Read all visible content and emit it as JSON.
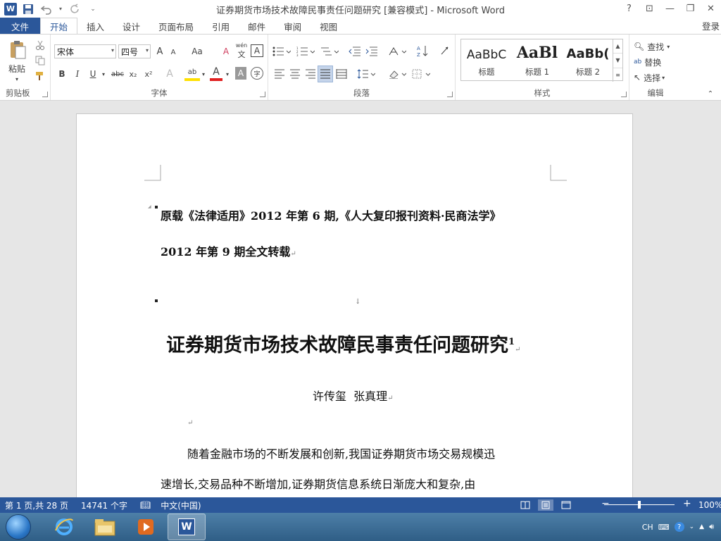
{
  "window": {
    "title": "证券期货市场技术故障民事责任问题研究 [兼容模式] - Microsoft Word",
    "app_icon": "W"
  },
  "quick_access": [
    {
      "icon": "save-icon",
      "glyph": "💾"
    },
    {
      "icon": "undo-icon",
      "glyph": "↶"
    },
    {
      "icon": "redo-icon",
      "glyph": "↻"
    },
    {
      "icon": "customize-icon",
      "glyph": "⌄"
    }
  ],
  "window_buttons": {
    "help": "?",
    "ribbon_options": "⊡",
    "minimize": "—",
    "restore": "❐",
    "close": "✕"
  },
  "tabs": [
    {
      "label": "文件"
    },
    {
      "label": "开始"
    },
    {
      "label": "插入"
    },
    {
      "label": "设计"
    },
    {
      "label": "页面布局"
    },
    {
      "label": "引用"
    },
    {
      "label": "邮件"
    },
    {
      "label": "审阅"
    },
    {
      "label": "视图"
    }
  ],
  "login_label": "登录",
  "ribbon": {
    "clipboard": {
      "label": "剪贴板",
      "paste": "粘贴"
    },
    "font": {
      "label": "字体",
      "font_name": "宋体",
      "font_size": "四号",
      "bold": "B",
      "italic": "I",
      "underline": "U",
      "strike": "abc",
      "subscript": "x₂",
      "superscript": "x²",
      "grow": "A",
      "shrink": "A",
      "case": "Aa",
      "clear": "A",
      "phonetic": "wén",
      "border_char": "A",
      "effects": "A",
      "highlight": "ab",
      "font_color": "A",
      "shading": "A",
      "enclose": "字"
    },
    "paragraph": {
      "label": "段落"
    },
    "styles": {
      "label": "样式",
      "items": [
        {
          "sample": "AaBbC",
          "name": "标题"
        },
        {
          "sample": "AaBl",
          "name": "标题 1"
        },
        {
          "sample": "AaBb(",
          "name": "标题 2"
        }
      ]
    },
    "editing": {
      "label": "编辑",
      "find": "查找",
      "replace": "替换",
      "select": "选择"
    }
  },
  "document": {
    "source_line1": "原载《法律适用》2012 年第 6 期,《人大复印报刊资料·民商法学》",
    "source_line2": "2012 年第 9 期全文转载",
    "title": "证券期货市场技术故障民事责任问题研究",
    "title_footnote": "1",
    "authors": "许传玺  张真理",
    "body_line1": "随着金融市场的不断发展和创新,我国证券期货市场交易规模迅",
    "body_line2": "速增长,交易品种不断增加,证券期货信息系统日渐庞大和复杂,由",
    "para_mark": "↵",
    "line_break_mark": "↓"
  },
  "status": {
    "page": "第 1 页,共 28 页",
    "words": "14741 个字",
    "language": "中文(中国)",
    "zoom": "100%",
    "zoom_level": 0.5
  },
  "taskbar": {
    "apps": [
      {
        "icon": "ie-icon"
      },
      {
        "icon": "explorer-icon"
      },
      {
        "icon": "media-player-icon"
      },
      {
        "icon": "word-icon"
      }
    ],
    "tray": {
      "ime": "CH"
    }
  },
  "colors": {
    "word_blue": "#2b579a",
    "taskbar": "#3c6e98"
  }
}
